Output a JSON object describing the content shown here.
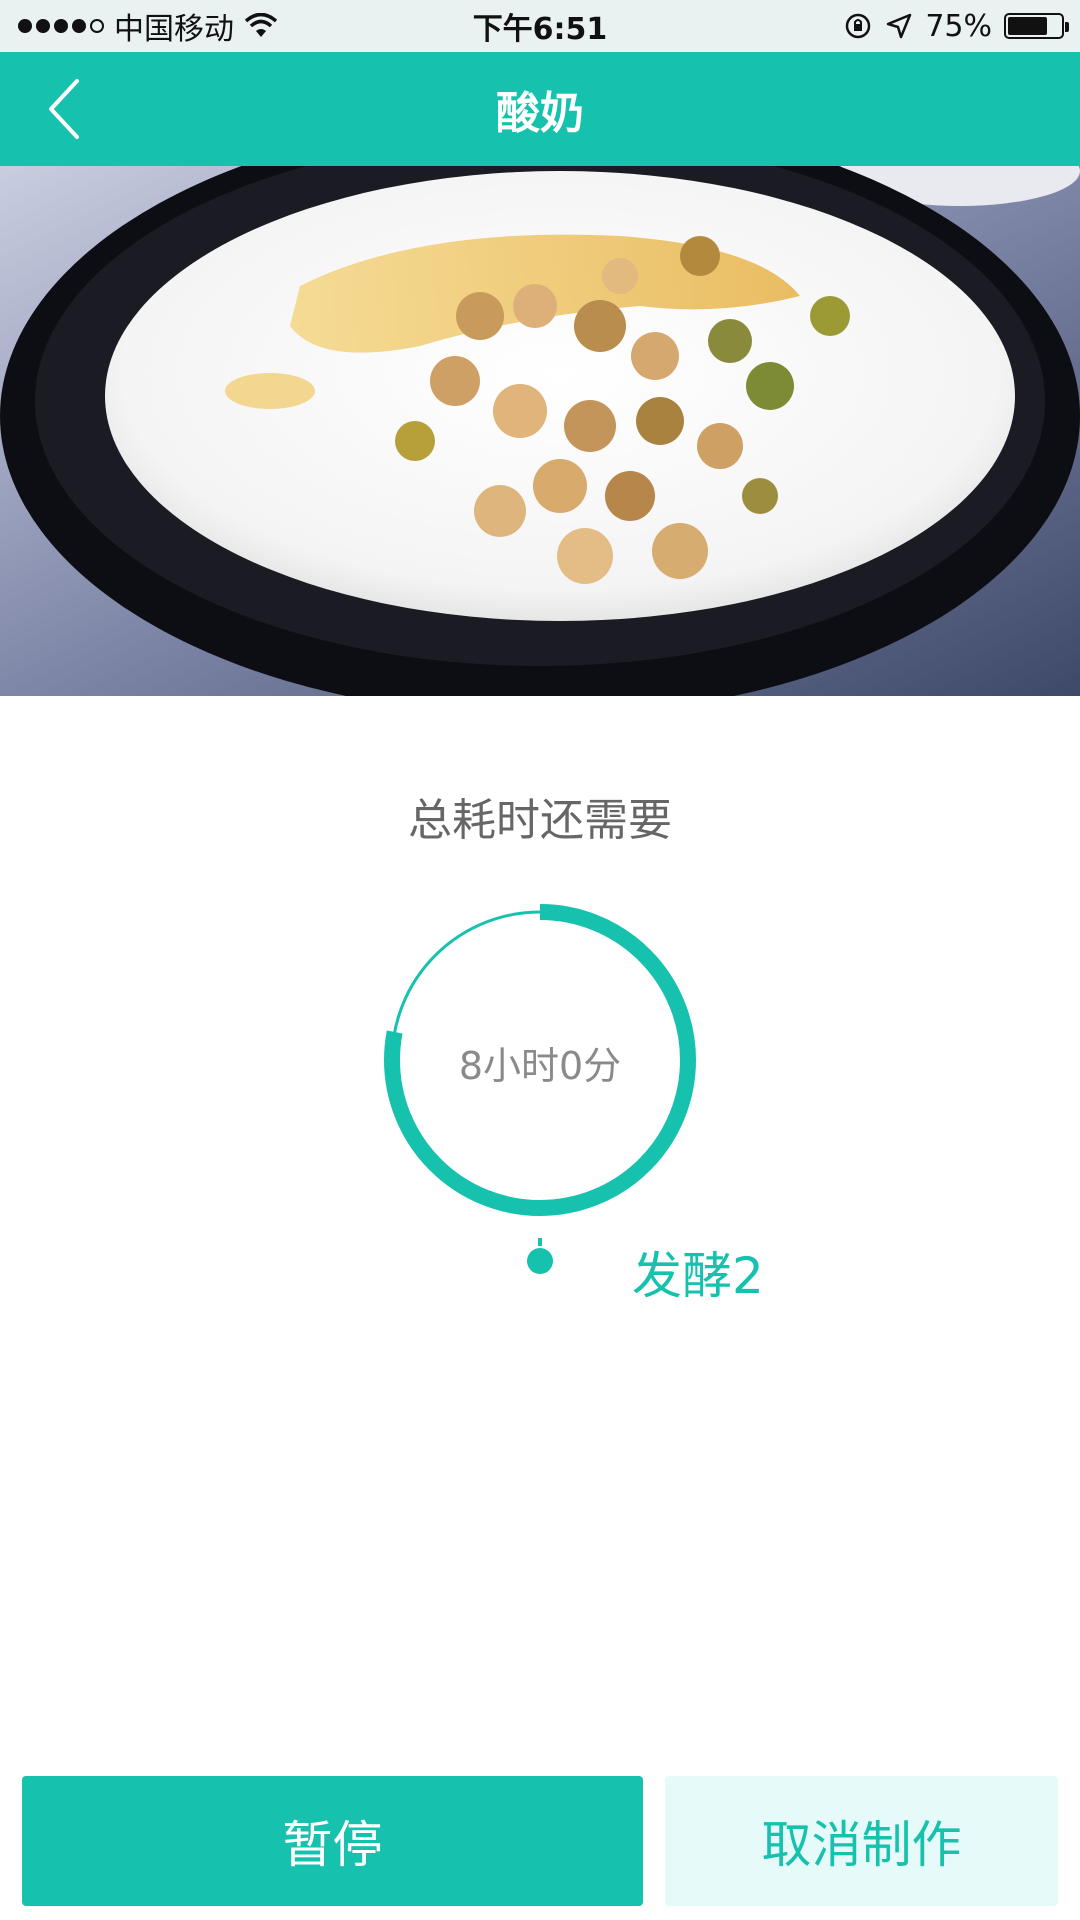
{
  "status_bar": {
    "carrier": "中国移动",
    "time": "下午6:51",
    "battery_text": "75%",
    "battery_level": 0.75,
    "icons": [
      "signal-dots-icon",
      "wifi-icon",
      "orientation-lock-icon",
      "location-arrow-icon",
      "battery-icon"
    ]
  },
  "nav": {
    "title": "酸奶",
    "back_icon": "chevron-left-icon"
  },
  "hero": {
    "image": "yogurt-bowl-with-walnuts-and-raisins"
  },
  "timer": {
    "label": "总耗时还需要",
    "remaining": "8小时0分",
    "progress_fraction": 0.22,
    "step_label": "发酵2"
  },
  "actions": {
    "pause_label": "暂停",
    "cancel_label": "取消制作"
  },
  "colors": {
    "accent": "#16c2ad",
    "cancel_bg": "#e6fbf9",
    "status_bg": "#eaf1f1"
  }
}
